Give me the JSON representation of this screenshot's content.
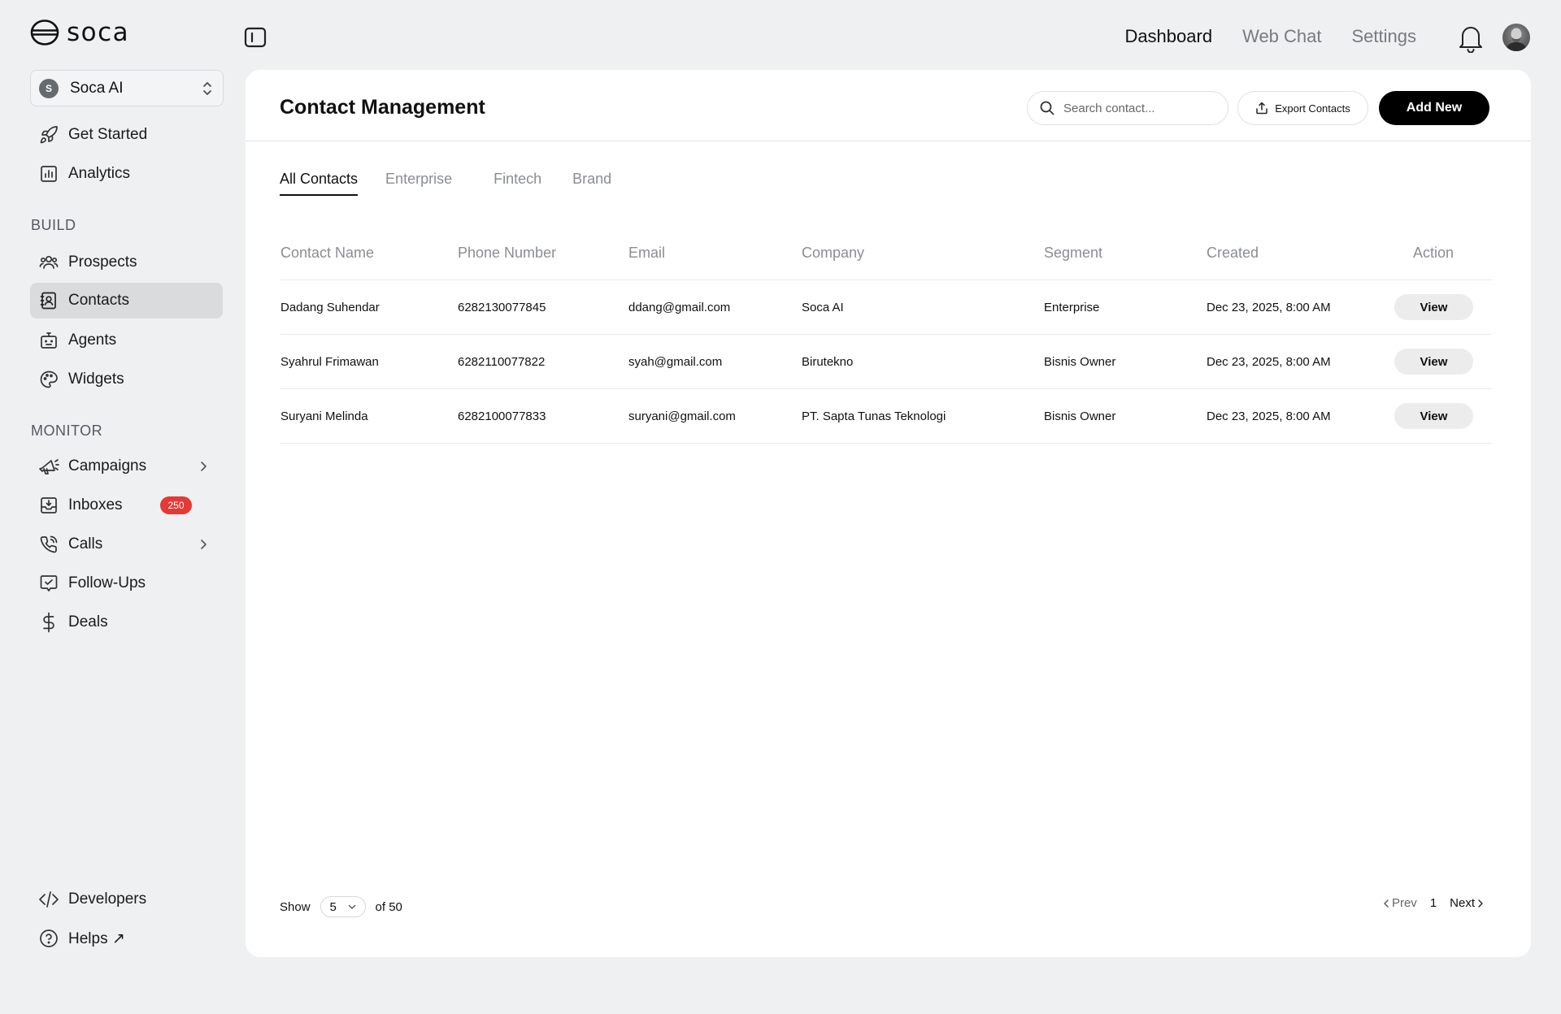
{
  "brand": {
    "name": "soca"
  },
  "org": {
    "initial": "S",
    "name": "Soca AI"
  },
  "sidebar": {
    "top_items": [
      {
        "label": "Get Started",
        "icon": "rocket-icon"
      },
      {
        "label": "Analytics",
        "icon": "chart-icon"
      }
    ],
    "build_label": "BUILD",
    "build_items": [
      {
        "label": "Prospects",
        "icon": "users-icon"
      },
      {
        "label": "Contacts",
        "icon": "contact-book-icon",
        "active": true
      },
      {
        "label": "Agents",
        "icon": "robot-icon"
      },
      {
        "label": "Widgets",
        "icon": "palette-icon"
      }
    ],
    "monitor_label": "MONITOR",
    "monitor_items": [
      {
        "label": "Campaigns",
        "icon": "megaphone-icon",
        "chevron": true
      },
      {
        "label": "Inboxes",
        "icon": "inbox-icon",
        "badge": "250"
      },
      {
        "label": "Calls",
        "icon": "phone-icon",
        "chevron": true
      },
      {
        "label": "Follow-Ups",
        "icon": "check-message-icon"
      },
      {
        "label": "Deals",
        "icon": "dollar-icon"
      }
    ],
    "bottom_items": [
      {
        "label": "Developers",
        "icon": "code-icon"
      },
      {
        "label": "Helps ↗",
        "icon": "help-icon"
      }
    ]
  },
  "topnav": {
    "items": [
      "Dashboard",
      "Web Chat",
      "Settings"
    ],
    "active": "Dashboard"
  },
  "page": {
    "title": "Contact Management",
    "search_placeholder": "Search contact...",
    "export_label": "Export Contacts",
    "add_label": "Add New"
  },
  "tabs": [
    "All Contacts",
    "Enterprise",
    "Fintech",
    "Brand"
  ],
  "table": {
    "columns": [
      "Contact Name",
      "Phone Number",
      "Email",
      "Company",
      "Segment",
      "Created",
      "Action"
    ],
    "rows": [
      {
        "name": "Dadang Suhendar",
        "phone": "6282130077845",
        "email": "ddang@gmail.com",
        "company": "Soca AI",
        "segment": "Enterprise",
        "created": "Dec 23, 2025, 8:00 AM",
        "action": "View"
      },
      {
        "name": "Syahrul Frimawan",
        "phone": "6282110077822",
        "email": "syah@gmail.com",
        "company": "Birutekno",
        "segment": "Bisnis Owner",
        "created": "Dec 23, 2025, 8:00 AM",
        "action": "View"
      },
      {
        "name": "Suryani Melinda",
        "phone": "6282100077833",
        "email": "suryani@gmail.com",
        "company": "PT. Sapta Tunas Teknologi",
        "segment": "Bisnis Owner",
        "created": "Dec 23, 2025, 8:00 AM",
        "action": "View"
      }
    ]
  },
  "pagination": {
    "show_label": "Show",
    "page_size": "5",
    "total_label": "of 50",
    "prev_label": "Prev",
    "current_page": "1",
    "next_label": "Next"
  },
  "colors": {
    "accent": "#000000",
    "badge": "#e53935",
    "active_nav": "#dadbdd",
    "background": "#eef0f2"
  }
}
